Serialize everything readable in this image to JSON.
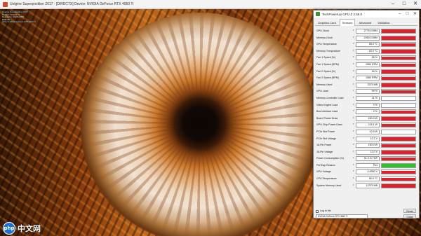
{
  "render_window": {
    "title": "Unigine Superposition 2017 · [DIRECTX] Device: NVIDIA GeForce RTX 4060 Ti",
    "minimize_icon": "minimize-icon",
    "maximize_icon": "maximize-icon",
    "close_icon": "close-icon",
    "overlay_lines": [
      "Unigine Superposition 2017",
      "Render: DirectX 11",
      "Resolution: 1920x1080",
      "FPS: 58",
      "GPU: NVIDIA GeForce RTX 4060 Ti"
    ]
  },
  "watermark": {
    "badge": "php",
    "text": "中文网"
  },
  "gpuz": {
    "title": "TechPowerUp GPU-Z 2.59.0",
    "tabs": [
      {
        "label": "Graphics Card",
        "active": false
      },
      {
        "label": "Sensors",
        "active": true
      },
      {
        "label": "Advanced",
        "active": false
      },
      {
        "label": "Validation",
        "active": false
      }
    ],
    "accent_red": "#d9232d",
    "accent_green": "#2fbf2f",
    "sensors": [
      {
        "label": "GPU Clock",
        "value": "2775.0 MHz",
        "level": 0.92,
        "color": "red"
      },
      {
        "label": "Memory Clock",
        "value": "2250.0 MHz",
        "level": 0.92,
        "color": "red"
      },
      {
        "label": "GPU Temperature",
        "value": "65.0 °C",
        "level": 0.9,
        "color": "red"
      },
      {
        "label": "Memory Temperature",
        "value": "62.0 °C",
        "level": 0.9,
        "color": "red"
      },
      {
        "label": "Fan 1 Speed (%)",
        "value": "55 %",
        "level": 0.85,
        "color": "red"
      },
      {
        "label": "Fan 1 Speed (RPM)",
        "value": "1560 RPM",
        "level": 0.88,
        "color": "red"
      },
      {
        "label": "Fan 2 Speed (%)",
        "value": "55 %",
        "level": 0.85,
        "color": "red"
      },
      {
        "label": "Fan 2 Speed (RPM)",
        "value": "1560 RPM",
        "level": 0.88,
        "color": "red"
      },
      {
        "label": "Memory Used",
        "value": "2375 MB",
        "level": 0.88,
        "color": "red"
      },
      {
        "label": "GPU Load",
        "value": "99 %",
        "level": 0.92,
        "color": "red"
      },
      {
        "label": "Memory Controller Load",
        "value": "41 %",
        "level": 0.06,
        "color": "red"
      },
      {
        "label": "Video Engine Load",
        "value": "0 %",
        "level": 0.0,
        "color": "red"
      },
      {
        "label": "Bus Interface Load",
        "value": "2 %",
        "level": 0.92,
        "color": "red"
      },
      {
        "label": "Board Power Draw",
        "value": "160.0 W",
        "level": 0.9,
        "color": "red"
      },
      {
        "label": "GPU Chip Power Draw",
        "value": "115.1 W",
        "level": 0.9,
        "color": "red"
      },
      {
        "label": "PCIe Slot Power",
        "value": "10.5 W",
        "level": 0.06,
        "color": "red"
      },
      {
        "label": "PCIe Slot Voltage",
        "value": "12.1 V",
        "level": 0.9,
        "color": "red"
      },
      {
        "label": "16-Pin Power",
        "value": "150.0 W",
        "level": 0.9,
        "color": "red"
      },
      {
        "label": "16-Pin Voltage",
        "value": "12.0 V",
        "level": 0.9,
        "color": "red"
      },
      {
        "label": "Power Consumption (%)",
        "value": "91.3 % TDP",
        "level": 0.92,
        "color": "red"
      },
      {
        "label": "PerfCap Reason",
        "value": "Pwr",
        "level": 1.0,
        "color": "green"
      },
      {
        "label": "GPU Voltage",
        "value": "0.9950 V",
        "level": 0.9,
        "color": "red"
      },
      {
        "label": "CPU Temperature",
        "value": "60.0 °C",
        "level": 0.9,
        "color": "red"
      },
      {
        "label": "System Memory Used",
        "value": "12375 MB",
        "level": 0.9,
        "color": "red"
      }
    ],
    "log_label": "Log to file",
    "reset_label": "Reset",
    "gpu_select": "NVIDIA GeForce RTX 4060 Ti",
    "close_label": "Close"
  }
}
